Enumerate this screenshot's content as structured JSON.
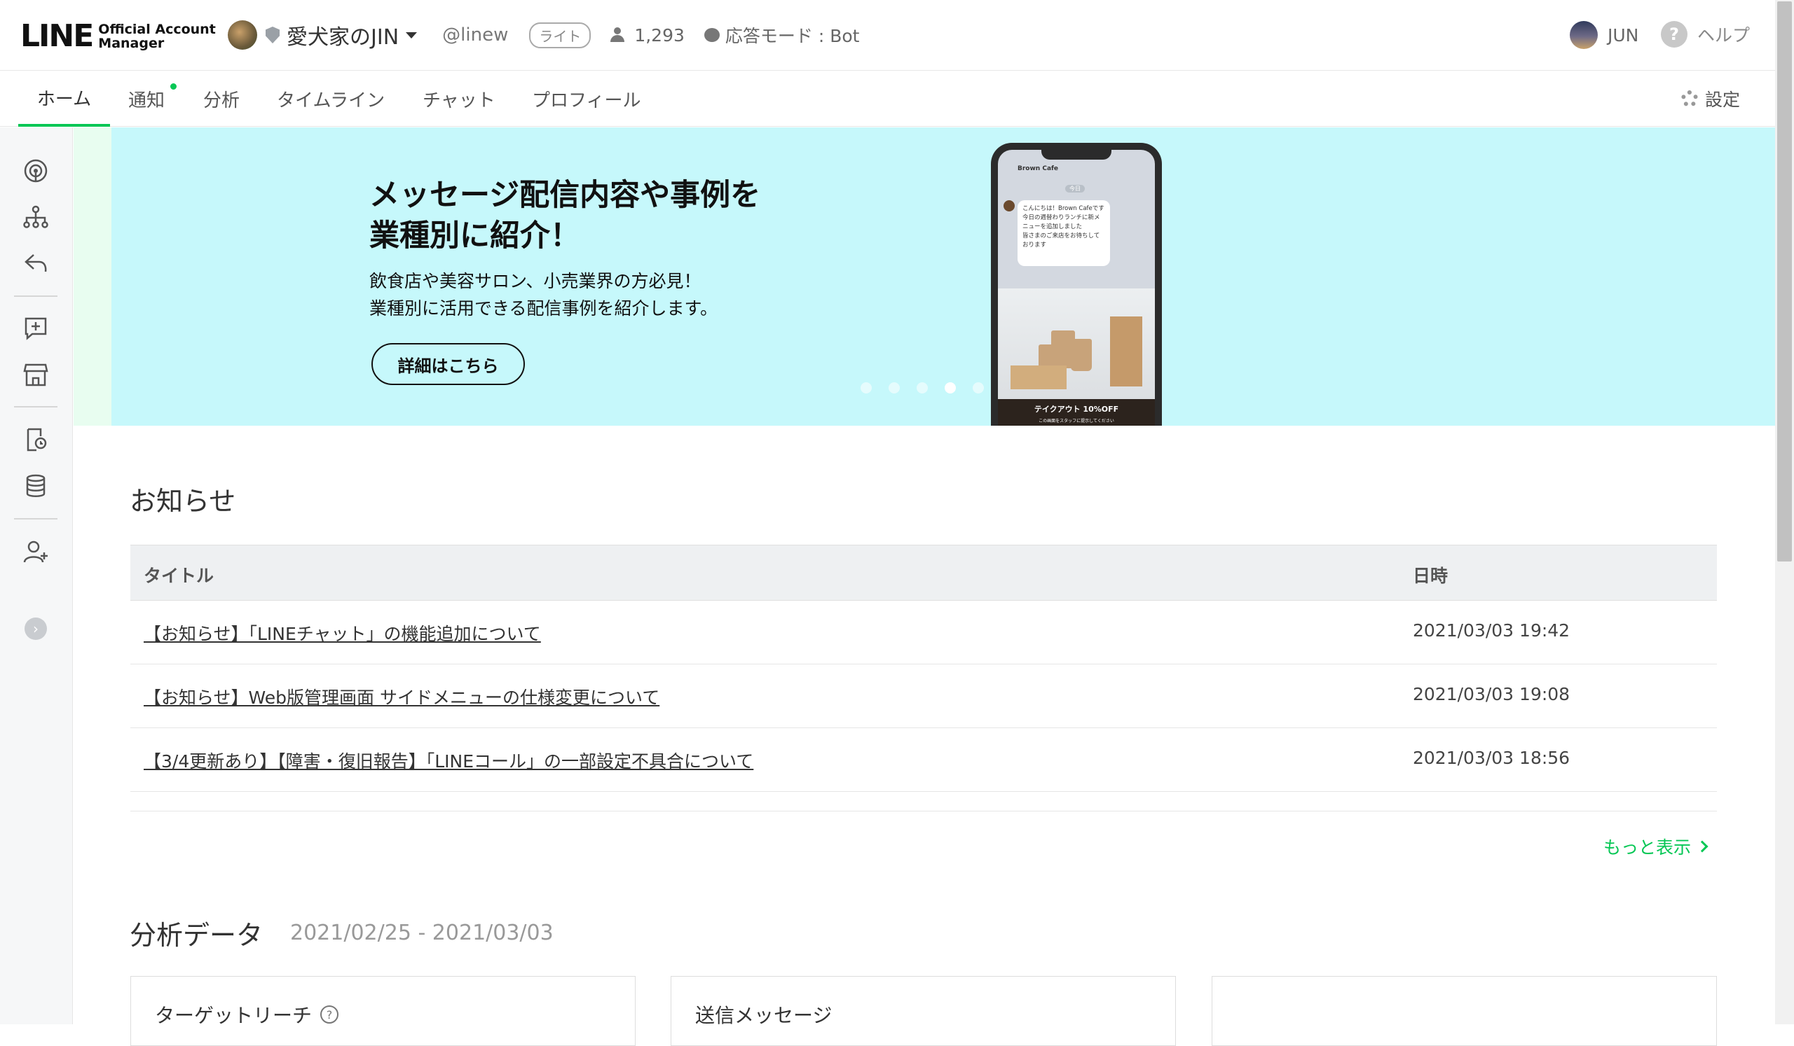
{
  "header": {
    "logo_main": "LINE",
    "logo_sub": "Official Account Manager",
    "account_name": "愛犬家のJIN",
    "account_id": "@linew",
    "plan_badge": "ライト",
    "followers": "1,293",
    "response_mode": "応答モード : Bot",
    "user_name": "JUN",
    "help_label": "ヘルプ"
  },
  "nav": {
    "tabs": [
      {
        "label": "ホーム"
      },
      {
        "label": "通知"
      },
      {
        "label": "分析"
      },
      {
        "label": "タイムライン"
      },
      {
        "label": "チャット"
      },
      {
        "label": "プロフィール"
      }
    ],
    "active_tab": "ホーム",
    "settings_label": "設定"
  },
  "sidebar": {
    "icons": [
      "broadcast-icon",
      "rich-menu-icon",
      "auto-reply-icon",
      "add-message-icon",
      "shop-icon",
      "coupon-icon",
      "data-icon",
      "add-friend-icon"
    ],
    "expand_glyph": "›"
  },
  "banner": {
    "title": "メッセージ配信内容や事例を\n業種別に紹介！",
    "description": "飲食店や美容サロン、小売業界の方必見！\n業種別に活用できる配信事例を紹介します。",
    "button_label": "詳細はこちら",
    "slide_count": 5,
    "active_slide": 4,
    "phone": {
      "chat_name": "Brown Cafe",
      "chat_day": "今日",
      "message": "こんにちは！Brown Cafeです\n今日の週替わりランチに新メニューを追加しました\n皆さまのご来店をお待ちしております",
      "footer_text": "テイクアウト 10%OFF",
      "footer_sub": "この画面をスタッフに提示してください"
    }
  },
  "news": {
    "heading": "お知らせ",
    "col_title": "タイトル",
    "col_date": "日時",
    "rows": [
      {
        "title": "【お知らせ】「LINEチャット」の機能追加について",
        "date": "2021/03/03 19:42"
      },
      {
        "title": "【お知らせ】Web版管理画面 サイドメニューの仕様変更について",
        "date": "2021/03/03 19:08"
      },
      {
        "title": "【3/4更新あり】【障害・復旧報告】「LINEコール」の一部設定不具合について",
        "date": "2021/03/03 18:56"
      }
    ],
    "more_label": "もっと表示"
  },
  "analytics": {
    "heading": "分析データ",
    "date_range": "2021/02/25 - 2021/03/03",
    "cards": [
      {
        "title": "ターゲットリーチ",
        "has_help": true
      },
      {
        "title": "送信メッセージ",
        "has_help": false
      },
      {
        "title": "",
        "has_help": false
      }
    ]
  },
  "colors": {
    "accent": "#06c755",
    "banner_bg": "#c6f8fb"
  }
}
